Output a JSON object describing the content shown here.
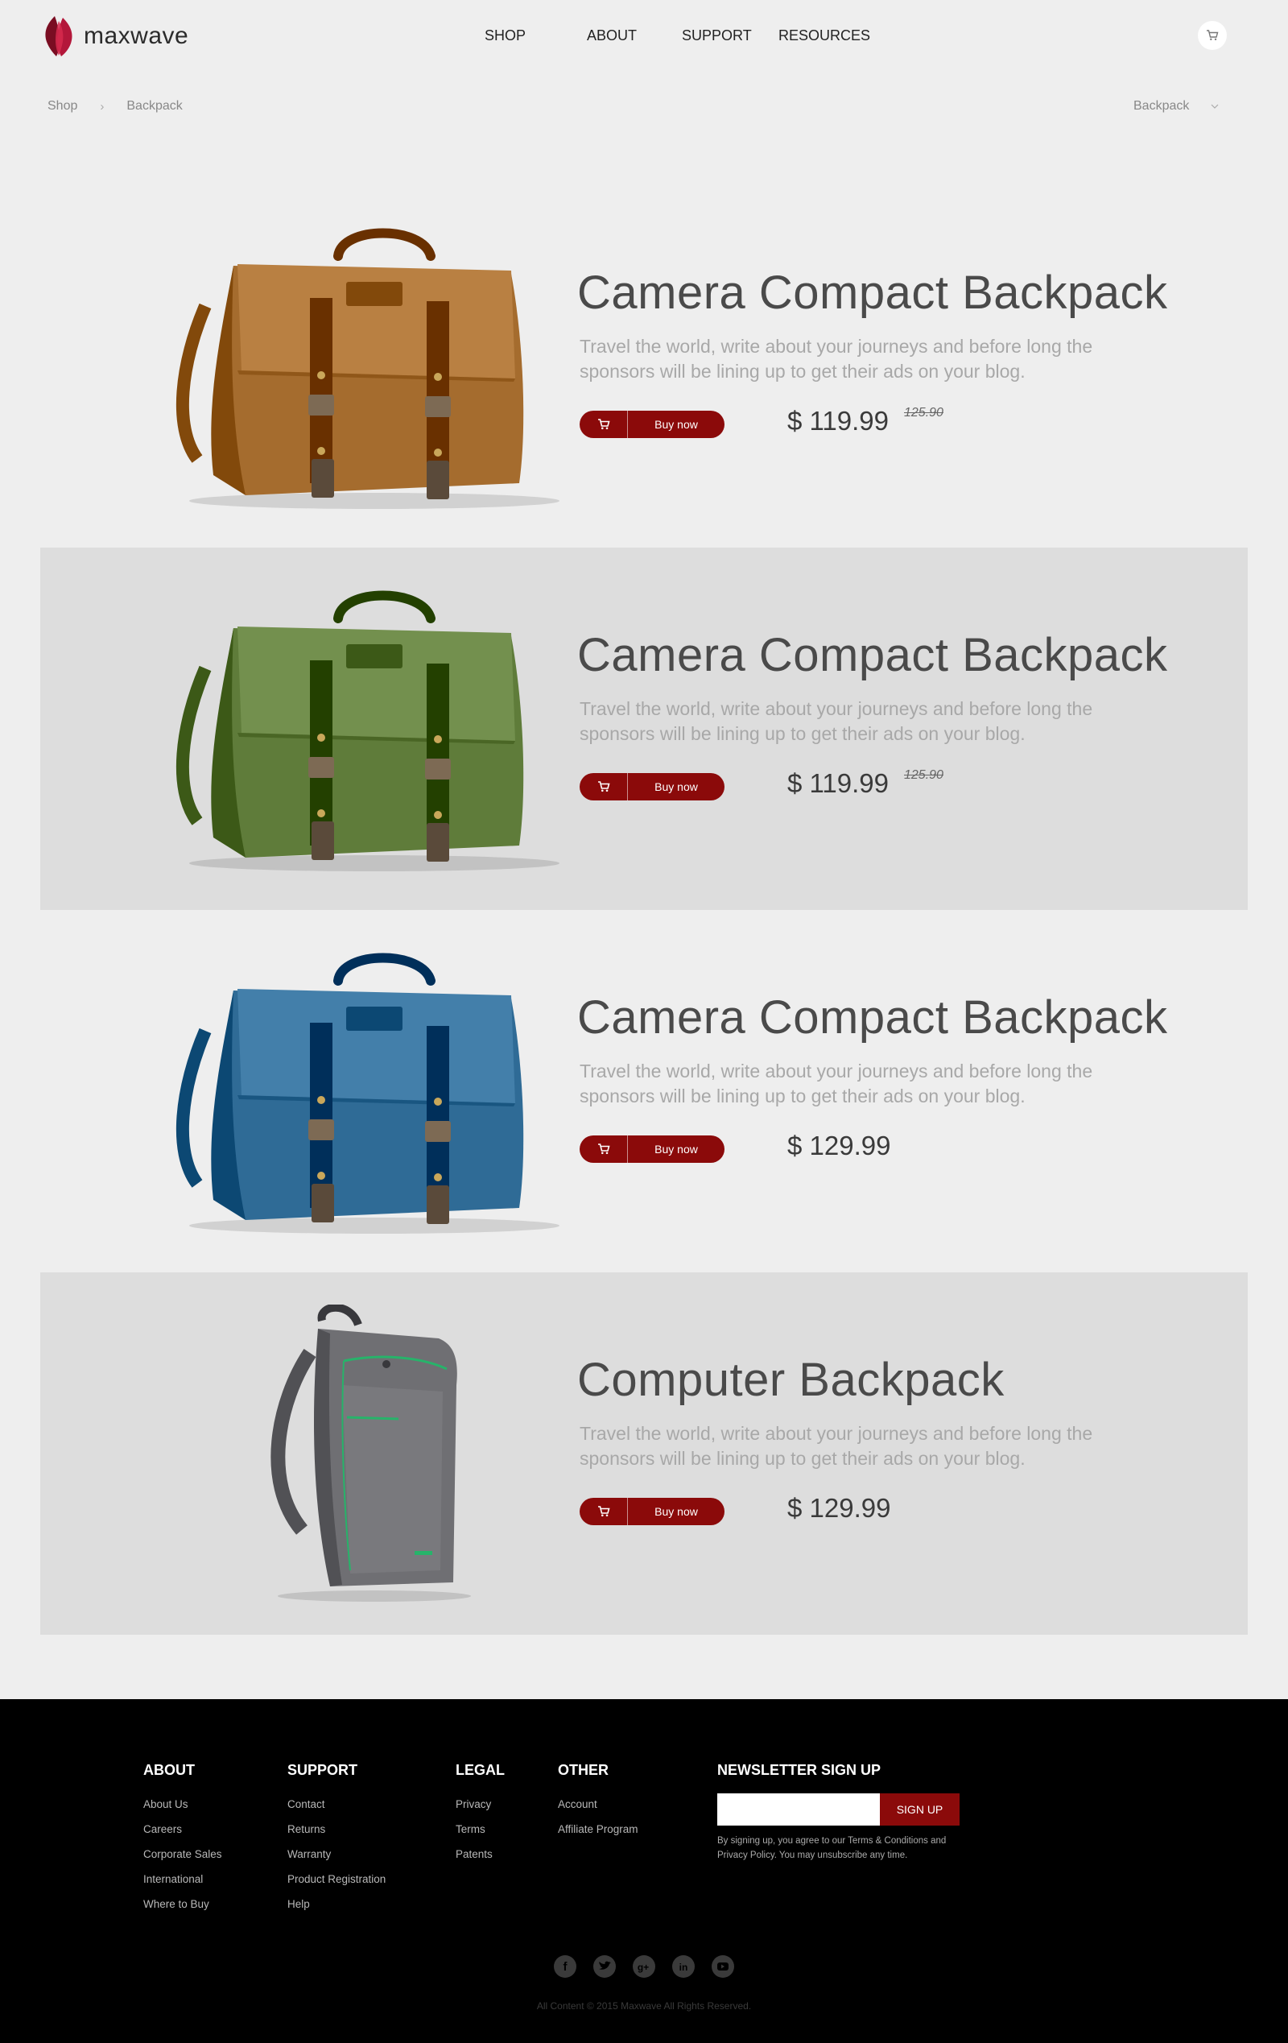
{
  "brand": {
    "name": "maxwave",
    "accent": "#8b0a0a",
    "logo_color": "#a0142a"
  },
  "nav": {
    "items": [
      {
        "label": "SHOP"
      },
      {
        "label": "ABOUT"
      },
      {
        "label": "SUPPORT"
      },
      {
        "label": "RESOURCES"
      }
    ],
    "cart_icon": "cart-icon"
  },
  "breadcrumb": {
    "items": [
      "Shop",
      "Backpack"
    ]
  },
  "filter": {
    "selected": "Backpack"
  },
  "products": [
    {
      "title": "Camera Compact Backpack",
      "description": "Travel the world, write about your journeys and before long the sponsors will be lining up to get their ads on your blog.",
      "button_label": "Buy now",
      "price": "$ 119.99",
      "old_price": "125.90",
      "color": "#a56c2e",
      "type": "messenger"
    },
    {
      "title": "Camera Compact Backpack",
      "description": "Travel the world, write about your journeys and before long the sponsors will be lining up to get their ads on your blog.",
      "button_label": "Buy now",
      "price": "$ 119.99",
      "old_price": "125.90",
      "color": "#5f7c3a",
      "type": "messenger"
    },
    {
      "title": "Camera Compact Backpack",
      "description": "Travel the world, write about your journeys and before long the sponsors will be lining up to get their ads on your blog.",
      "button_label": "Buy now",
      "price": "$ 129.99",
      "old_price": "",
      "color": "#2f6b96",
      "type": "messenger"
    },
    {
      "title": "Computer Backpack",
      "description": "Travel the world, write about your journeys and before long the sponsors will be lining up to get their ads on your blog.",
      "button_label": "Buy now",
      "price": "$ 129.99",
      "old_price": "",
      "color": "#6f6f73",
      "type": "backpack"
    }
  ],
  "footer": {
    "columns": [
      {
        "title": "ABOUT",
        "links": [
          "About Us",
          "Careers",
          "Corporate Sales",
          "International",
          "Where to Buy"
        ]
      },
      {
        "title": "SUPPORT",
        "links": [
          "Contact",
          "Returns",
          "Warranty",
          "Product Registration",
          "Help"
        ]
      },
      {
        "title": "LEGAL",
        "links": [
          "Privacy",
          "Terms",
          "Patents"
        ]
      },
      {
        "title": "OTHER",
        "links": [
          "Account",
          "Affiliate Program"
        ]
      }
    ],
    "newsletter": {
      "title": "NEWSLETTER SIGN UP",
      "placeholder": "",
      "button_label": "SIGN UP",
      "note": "By signing up, you agree to our Terms & Conditions and Privacy Policy. You may unsubscribe any time."
    },
    "socials": [
      "facebook-icon",
      "twitter-icon",
      "google-plus-icon",
      "linkedin-icon",
      "youtube-icon"
    ],
    "copyright": "All Content © 2015 Maxwave All Rights Reserved."
  }
}
